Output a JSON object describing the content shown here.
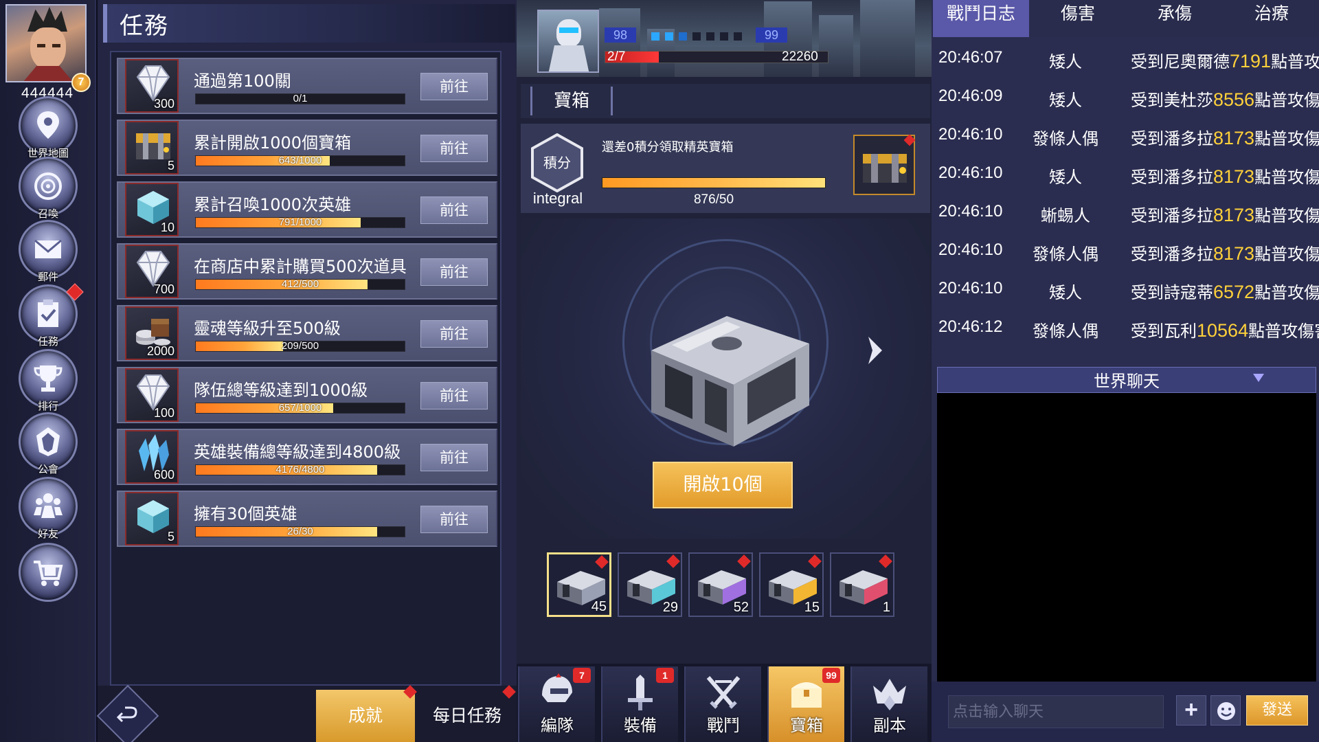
{
  "player": {
    "power": "444444",
    "level": "7"
  },
  "nav": [
    {
      "label": "世界地圖",
      "icon": "map-pin-icon"
    },
    {
      "label": "召喚",
      "icon": "summon-portal-icon"
    },
    {
      "label": "郵件",
      "icon": "mail-icon"
    },
    {
      "label": "任務",
      "icon": "clipboard-check-icon",
      "has_alert": true
    },
    {
      "label": "排行",
      "icon": "trophy-icon"
    },
    {
      "label": "公會",
      "icon": "guild-emblem-icon"
    },
    {
      "label": "好友",
      "icon": "friends-icon"
    },
    {
      "label": "",
      "icon": "shop-cart-icon"
    }
  ],
  "quests": {
    "title": "任務",
    "go_label": "前往",
    "items": [
      {
        "name": "通過第100關",
        "progress_text": "0/1",
        "progress": 0.0,
        "reward_icon": "diamond-icon",
        "reward_count": "300"
      },
      {
        "name": "累計開啟1000個寶箱",
        "progress_text": "643/1000",
        "progress": 0.643,
        "reward_icon": "treasure-chest-icon",
        "reward_count": "5"
      },
      {
        "name": "累計召喚1000次英雄",
        "progress_text": "791/1000",
        "progress": 0.791,
        "reward_icon": "crystal-cube-icon",
        "reward_count": "10"
      },
      {
        "name": "在商店中累計購買500次道具",
        "progress_text": "412/500",
        "progress": 0.824,
        "reward_icon": "diamond-icon",
        "reward_count": "700"
      },
      {
        "name": "靈魂等級升至500級",
        "progress_text": "209/500",
        "progress": 0.418,
        "reward_icon": "coins-icon",
        "reward_count": "2000"
      },
      {
        "name": "隊伍總等級達到1000級",
        "progress_text": "657/1000",
        "progress": 0.657,
        "reward_icon": "diamond-icon",
        "reward_count": "100"
      },
      {
        "name": "英雄裝備總等級達到4800級",
        "progress_text": "4176/4800",
        "progress": 0.87,
        "reward_icon": "blue-crystal-icon",
        "reward_count": "600"
      },
      {
        "name": "擁有30個英雄",
        "progress_text": "26/30",
        "progress": 0.867,
        "reward_icon": "crystal-cube-icon",
        "reward_count": "5"
      }
    ]
  },
  "quest_tabs": {
    "achievement": "成就",
    "daily": "每日任務"
  },
  "battle_status": {
    "left_level": "98",
    "right_level": "99",
    "wave": "2/7",
    "hp_value": "22260",
    "hp_ratio": 0.24
  },
  "chest": {
    "title": "寶箱",
    "points_badge": "積分",
    "points_label": "integral",
    "points_message": "還差0積分領取精英寶箱",
    "points_value": "876/50",
    "points_ratio": 1.0,
    "open_button": "開啟10個",
    "slots": [
      {
        "count": "45",
        "color": "#9aa0b4"
      },
      {
        "count": "29",
        "color": "#5bc8d8"
      },
      {
        "count": "52",
        "color": "#a070e0"
      },
      {
        "count": "15",
        "color": "#f2b632"
      },
      {
        "count": "1",
        "color": "#e0506e"
      }
    ]
  },
  "bottom_nav": [
    {
      "label": "編隊",
      "icon": "helmet-icon",
      "badge": "7"
    },
    {
      "label": "裝備",
      "icon": "sword-icon",
      "badge": "1"
    },
    {
      "label": "戰鬥",
      "icon": "crossed-swords-icon",
      "badge": ""
    },
    {
      "label": "寶箱",
      "icon": "chest-icon",
      "badge": "99"
    },
    {
      "label": "副本",
      "icon": "dungeon-crown-icon",
      "badge": ""
    }
  ],
  "log": {
    "tabs": [
      "戰鬥日志",
      "傷害",
      "承傷",
      "治療"
    ],
    "rows": [
      {
        "time": "20:46:07",
        "actor": "矮人",
        "pre": "受到尼奧爾德",
        "num": "7191",
        "post": "點普攻傷害"
      },
      {
        "time": "20:46:09",
        "actor": "矮人",
        "pre": "受到美杜莎",
        "num": "8556",
        "post": "點普攻傷害"
      },
      {
        "time": "20:46:10",
        "actor": "發條人偶",
        "pre": "受到潘多拉",
        "num": "8173",
        "post": "點普攻傷害"
      },
      {
        "time": "20:46:10",
        "actor": "矮人",
        "pre": "受到潘多拉",
        "num": "8173",
        "post": "點普攻傷害"
      },
      {
        "time": "20:46:10",
        "actor": "蜥蜴人",
        "pre": "受到潘多拉",
        "num": "8173",
        "post": "點普攻傷害"
      },
      {
        "time": "20:46:10",
        "actor": "發條人偶",
        "pre": "受到潘多拉",
        "num": "8173",
        "post": "點普攻傷害"
      },
      {
        "time": "20:46:10",
        "actor": "矮人",
        "pre": "受到詩寇蒂",
        "num": "6572",
        "post": "點普攻傷害"
      },
      {
        "time": "20:46:12",
        "actor": "發條人偶",
        "pre": "受到瓦利",
        "num": "10564",
        "post": "點普攻傷害"
      }
    ]
  },
  "chat": {
    "title": "世界聊天",
    "placeholder": "点击输入聊天",
    "send": "發送"
  },
  "colors": {
    "accent_gold": "#f2b632",
    "damage_number": "#ffd13a",
    "alert_red": "#e02a2a",
    "active_tab": "#5a58a8"
  }
}
